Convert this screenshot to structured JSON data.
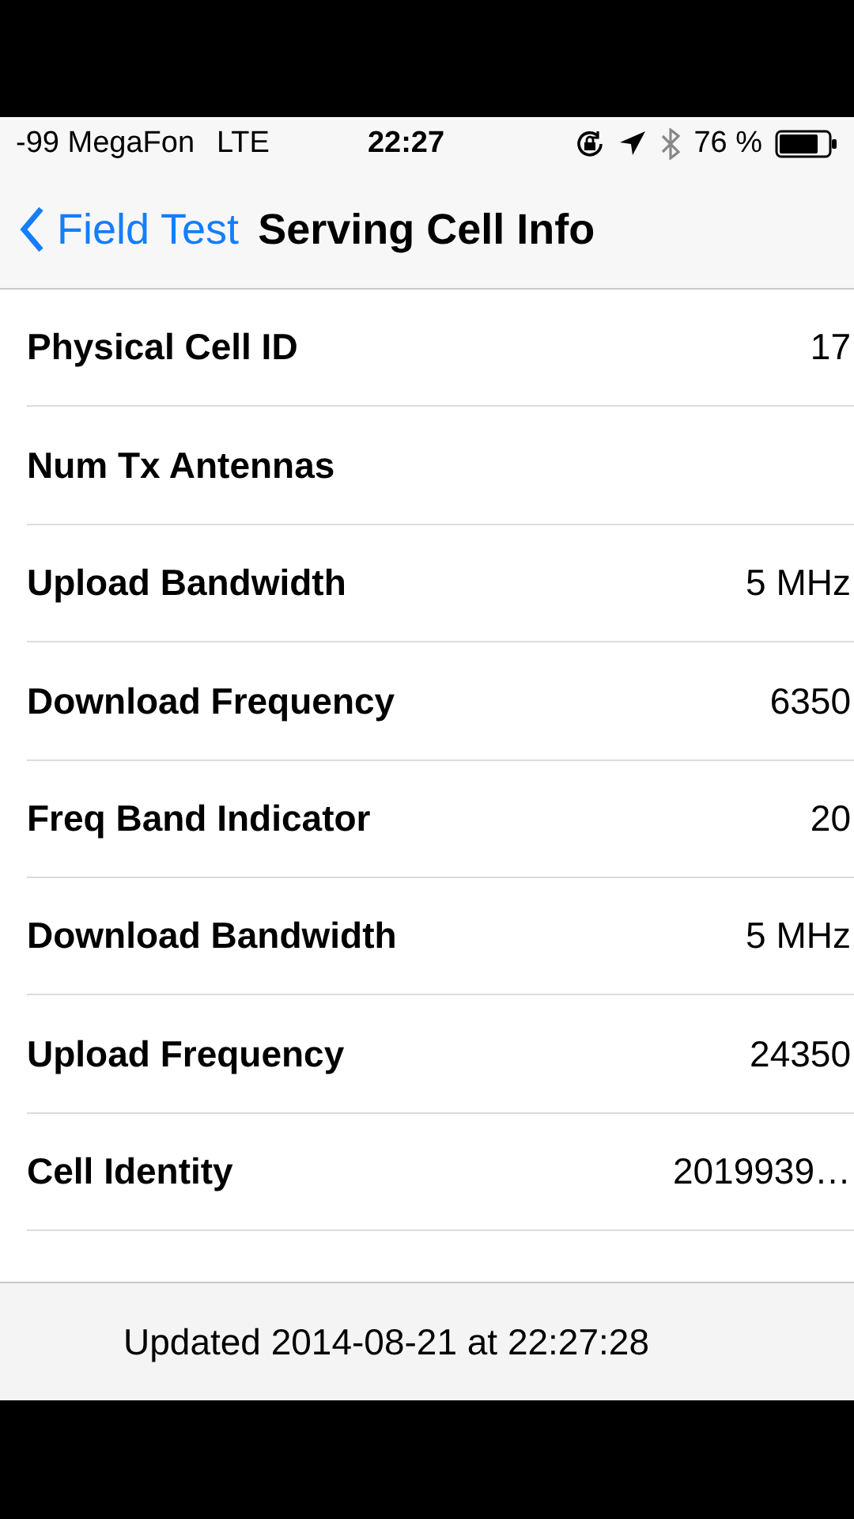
{
  "status_bar": {
    "signal": "-99 MegaFon",
    "network": "LTE",
    "time": "22:27",
    "battery": "76 %"
  },
  "nav_bar": {
    "back": "Field Test",
    "title": "Serving Cell Info"
  },
  "rows": [
    {
      "label": "Physical Cell ID",
      "value": "17"
    },
    {
      "label": "Num Tx Antennas"
    },
    {
      "label": "Upload Bandwidth",
      "value": "5 MHz"
    },
    {
      "label": "Download Frequency",
      "value": "6350"
    },
    {
      "label": "Freq Band Indicator",
      "value": "20"
    },
    {
      "label": "Download Bandwidth",
      "value": "5 MHz"
    },
    {
      "label": "Upload Frequency",
      "value": "24350"
    },
    {
      "label": "Cell Identity",
      "value": "2019939…"
    }
  ],
  "toolbar": {
    "text": "Updated 2014-08-21 at 22:27:28"
  }
}
